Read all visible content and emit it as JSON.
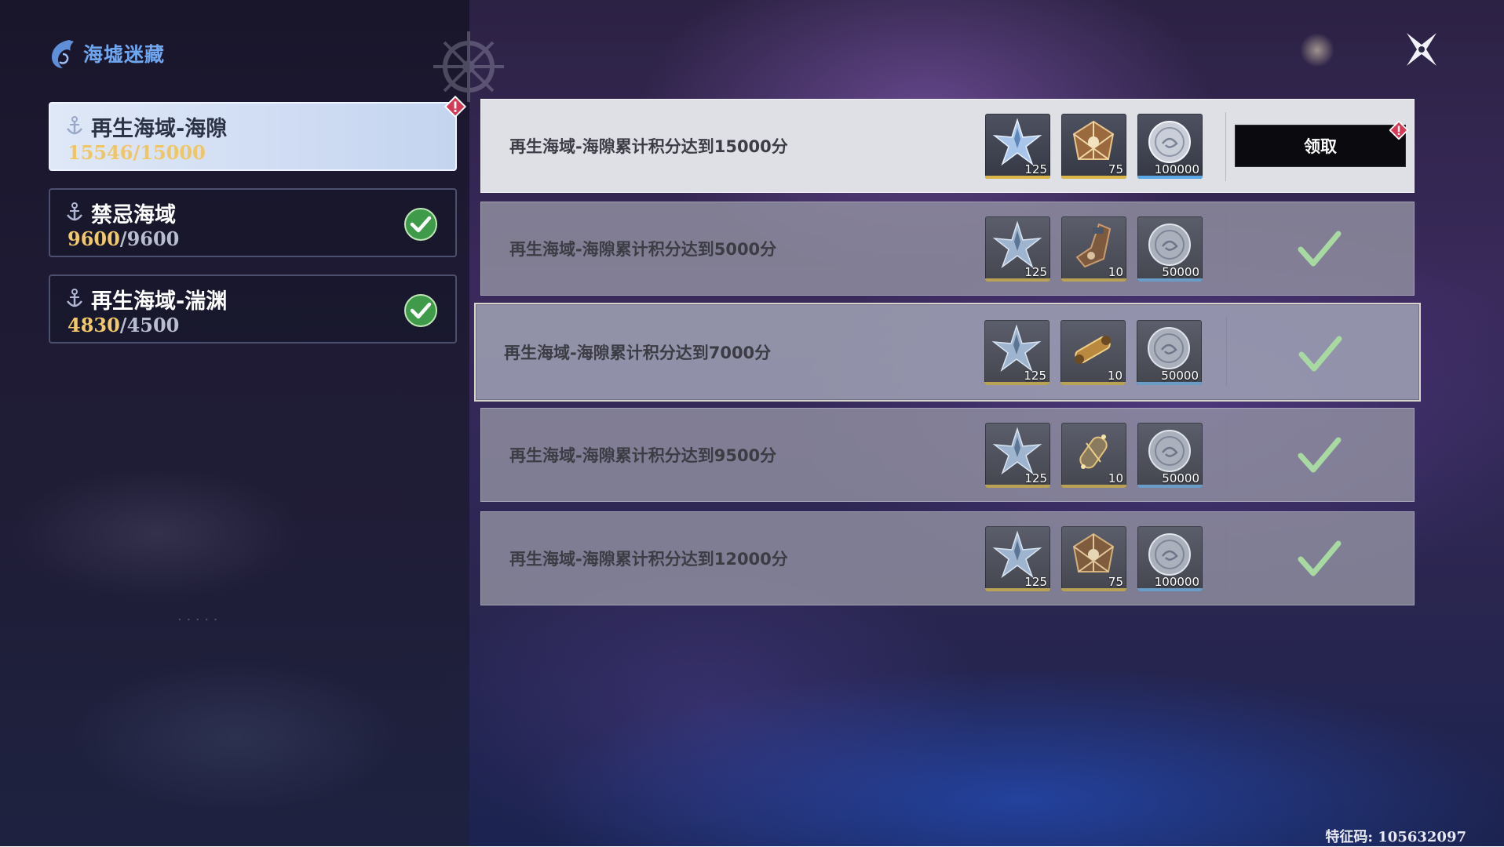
{
  "header": {
    "title": "海墟迷藏"
  },
  "regions": [
    {
      "name": "再生海域-海隙",
      "current": "15546",
      "max": "15000",
      "state": "active",
      "has_alert": true
    },
    {
      "name": "禁忌海域",
      "current": "9600",
      "max": "9600",
      "state": "completed",
      "has_alert": false
    },
    {
      "name": "再生海域-湍渊",
      "current": "4830",
      "max": "4500",
      "state": "completed",
      "has_alert": false
    }
  ],
  "score_separator": "/",
  "rewards": [
    {
      "label": "再生海域-海隙累计积分达到15000分",
      "items": [
        {
          "icon": "star-shard-icon",
          "qty": "125",
          "rarity": "#d9b54a"
        },
        {
          "icon": "bronze-cage-icon",
          "qty": "75",
          "rarity": "#d9b54a"
        },
        {
          "icon": "silver-coin-icon",
          "qty": "100000",
          "rarity": "#5aa7e6"
        }
      ],
      "status": "claimable",
      "button_label": "领取"
    },
    {
      "label": "再生海域-海隙累计积分达到5000分",
      "items": [
        {
          "icon": "star-shard-icon",
          "qty": "125",
          "rarity": "#b9a255"
        },
        {
          "icon": "bronze-gauntlet-icon",
          "qty": "10",
          "rarity": "#b9a255"
        },
        {
          "icon": "silver-coin-icon",
          "qty": "50000",
          "rarity": "#6a9cc8"
        }
      ],
      "status": "claimed"
    },
    {
      "label": "再生海域-海隙累计积分达到7000分",
      "items": [
        {
          "icon": "star-shard-icon",
          "qty": "125",
          "rarity": "#b9a255"
        },
        {
          "icon": "golden-scroll-icon",
          "qty": "10",
          "rarity": "#b9a255"
        },
        {
          "icon": "silver-coin-icon",
          "qty": "50000",
          "rarity": "#6a9cc8"
        }
      ],
      "status": "claimed"
    },
    {
      "label": "再生海域-海隙累计积分达到9500分",
      "items": [
        {
          "icon": "star-shard-icon",
          "qty": "125",
          "rarity": "#b9a255"
        },
        {
          "icon": "golden-capsule-icon",
          "qty": "10",
          "rarity": "#b9a255"
        },
        {
          "icon": "silver-coin-icon",
          "qty": "50000",
          "rarity": "#6a9cc8"
        }
      ],
      "status": "claimed"
    },
    {
      "label": "再生海域-海隙累计积分达到12000分",
      "items": [
        {
          "icon": "star-shard-icon",
          "qty": "125",
          "rarity": "#b9a255"
        },
        {
          "icon": "bronze-cage-icon",
          "qty": "75",
          "rarity": "#b9a255"
        },
        {
          "icon": "silver-coin-icon",
          "qty": "100000",
          "rarity": "#6a9cc8"
        }
      ],
      "status": "claimed"
    }
  ],
  "footer": {
    "uid_text": "特征码: 105632097"
  },
  "colors": {
    "accent_blue": "#6fa6f0",
    "score_gold": "#f2c86a",
    "check_green": "#8fcf8a",
    "alert_red": "#d43a55"
  }
}
